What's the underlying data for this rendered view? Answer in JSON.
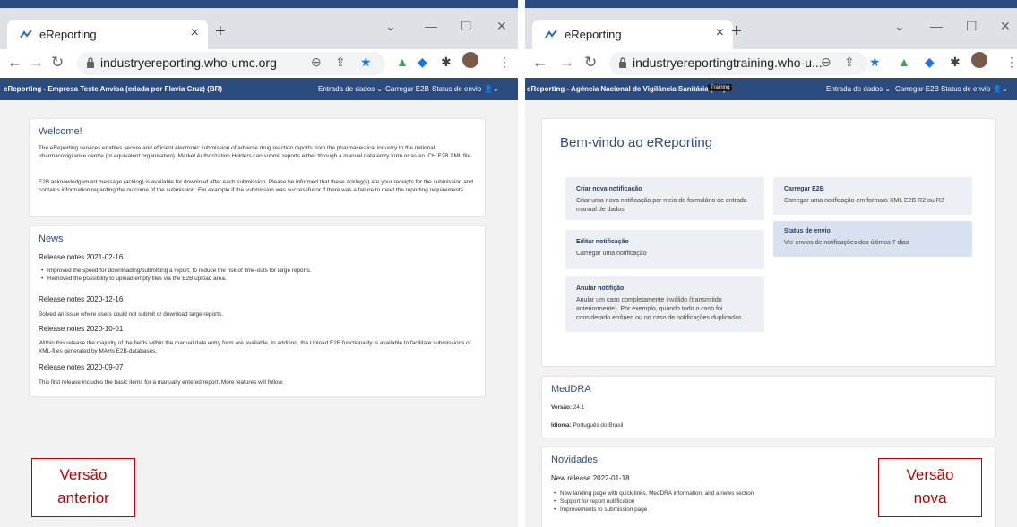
{
  "left": {
    "tab_title": "eReporting",
    "url": "industryereporting.who-umc.org",
    "app_brand": "eReporting - Empresa Teste Anvisa (criada por Flavia Cruz) (BR)",
    "menu": [
      "Entrada de dados",
      "Carregar E2B",
      "Status de envio"
    ],
    "welcome": {
      "title": "Welcome!",
      "p1": "The eReporting services enables secure and efficient electronic submission of adverse drug reaction reports from the pharmaceutical industry to the national pharmacovigilance centre (or equivalent organisation). Market Authorization Holders can submit reports either through a manual data entry form or as an ICH E2B XML file.",
      "p2": "E2B acknowledgement message (acklog) is available for download after each submission. Please be informed that these acklog(s) are your receipts for the submission and contains information regarding the outcome of the submission. For example if the submission was successful or if there was a failure to meet the reporting requirements."
    },
    "news": {
      "title": "News",
      "r1_title": "Release notes 2021-02-16",
      "r1_items": [
        "Improved the speed for downloading/submitting a report, to reduce the risk of time-outs for large reports.",
        "Removed the possibility to upload empty files via the E2B upload area."
      ],
      "r2_title": "Release notes 2020-12-16",
      "r2_text": "Solved an issue where users could not submit or download large reports.",
      "r3_title": "Release notes 2020-10-01",
      "r3_text": "Within this release the majority of the fields within the manual data entry form are available. In addition, the Upload E2B functionality is available to facilitate submissions of XML-files generated by MAHs E2B-databases.",
      "r4_title": "Release notes 2020-09-07",
      "r4_text": "This first release includes the basic items for a manually entered report. More features will follow."
    },
    "label_line1": "Versão",
    "label_line2": "anterior"
  },
  "right": {
    "tab_title": "eReporting",
    "url": "industryereportingtraining.who-u...",
    "app_brand": "eReporting - Agência Nacional de Vigilância Sanitária (BR)",
    "badge": "Training",
    "menu": [
      "Entrada de dados",
      "Carregar E2B",
      "Status de envio"
    ],
    "welcome_title": "Bem-vindo ao eReporting",
    "tiles": [
      {
        "title": "Criar nova notificação",
        "desc": "Criar uma nova notificação por meio do formulário de entrada manual de dados"
      },
      {
        "title": "Carregar E2B",
        "desc": "Carregar uma notificação em formato XML E2B R2 ou R3"
      },
      {
        "title": "Editar notificação",
        "desc": "Carregar uma notificação"
      },
      {
        "title": "Status de envio",
        "desc": "Ver envios de notificações dos últimos 7 dias"
      },
      {
        "title": "Anular notifição",
        "desc": "Anular um caso completamente inválido (transmitido anteriormente). Por exemplo, quando todo o caso foi considerado errôneo ou no caso de notificações duplicadas."
      }
    ],
    "meddra": {
      "title": "MedDRA",
      "version_label": "Versão:",
      "version_value": "24.1",
      "lang_label": "Idioma:",
      "lang_value": "Português do Brasil"
    },
    "news": {
      "title": "Novidades",
      "release": "New release 2022-01-18",
      "items": [
        "New landing page with quick links, MedDRA information, and a news section",
        "Support for report nullification",
        "Improvements to submission page"
      ]
    },
    "label_line1": "Versão",
    "label_line2": "nova"
  }
}
